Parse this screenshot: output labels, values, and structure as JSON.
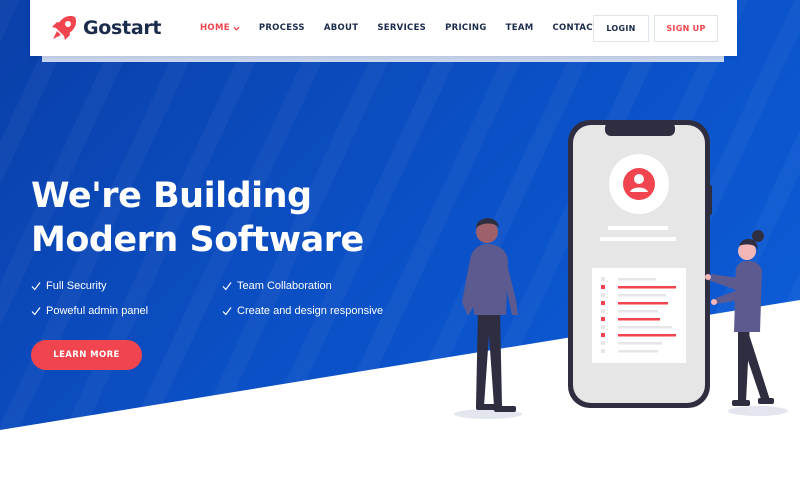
{
  "brand": {
    "name": "Gostart",
    "logo_icon": "rocket-icon",
    "accent": "#f0444e"
  },
  "nav": {
    "items": [
      {
        "id": "home",
        "label": "HOME",
        "active": true,
        "has_dropdown": true
      },
      {
        "id": "process",
        "label": "PROCESS"
      },
      {
        "id": "about",
        "label": "ABOUT"
      },
      {
        "id": "services",
        "label": "SERVICES"
      },
      {
        "id": "pricing",
        "label": "PRICING"
      },
      {
        "id": "team",
        "label": "TEAM"
      },
      {
        "id": "contact",
        "label": "CONTACT"
      }
    ],
    "login_label": "LOGIN",
    "signup_label": "SIGN UP"
  },
  "hero": {
    "headline_line1": "We're Building",
    "headline_line2": "Modern Software",
    "features": [
      "Full Security",
      "Team Collaboration",
      "Poweful admin panel",
      "Create and design responsive"
    ],
    "cta_label": "LEARN MORE",
    "background_color": "#0b4fc4"
  },
  "illustration": {
    "icons": [
      "user-profile-icon"
    ]
  }
}
